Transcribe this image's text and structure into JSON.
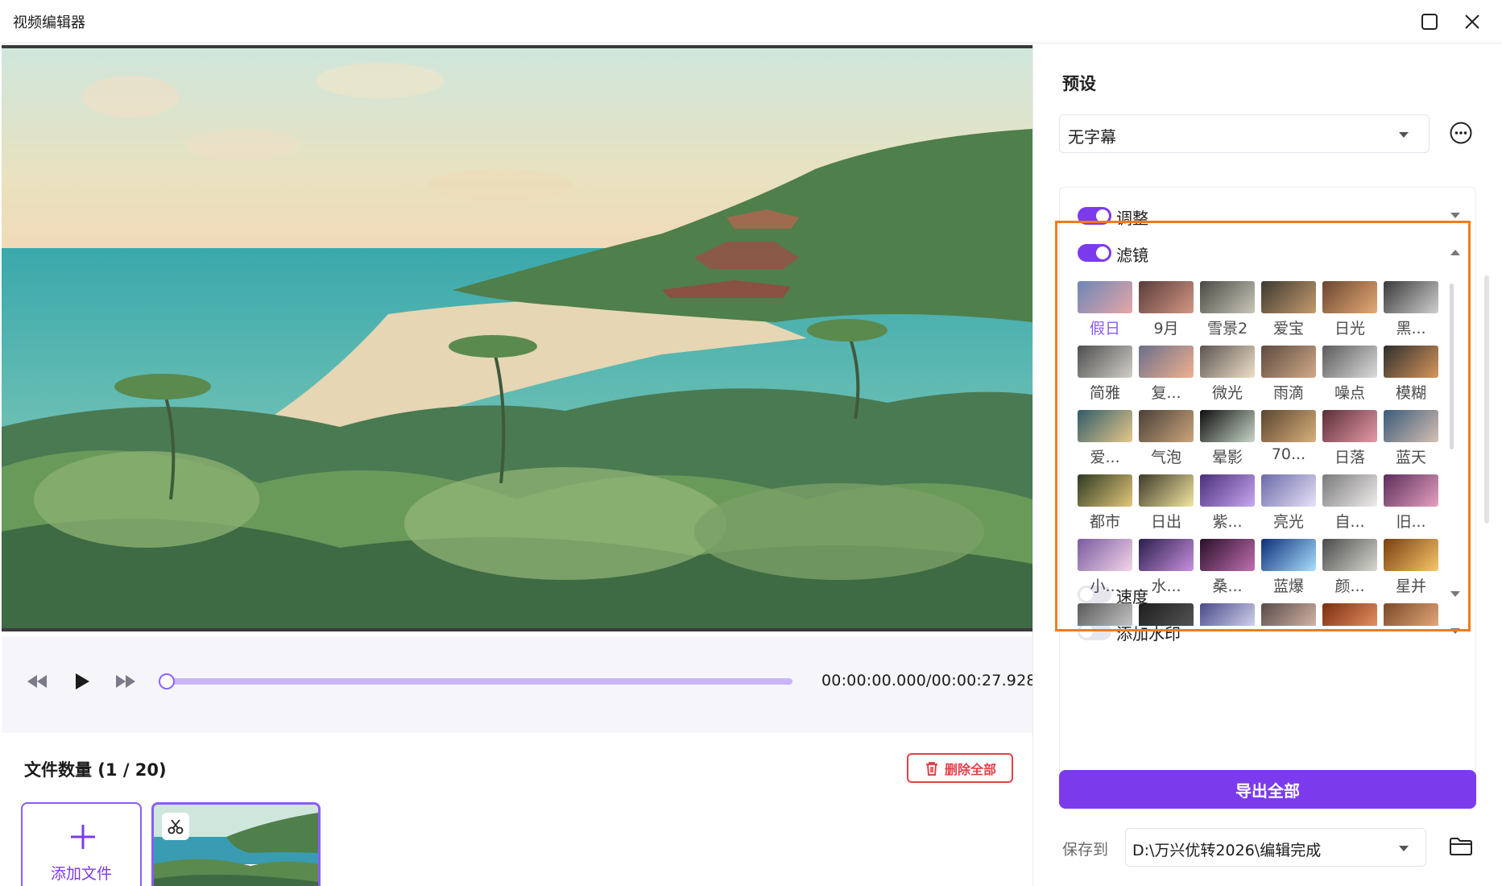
{
  "window": {
    "title": "视频编辑器"
  },
  "player": {
    "timecode": "00:00:00.000/00:00:27.928",
    "progress": 0.0
  },
  "files": {
    "count_label": "文件数量 (1 / 20)",
    "delete_all_label": "删除全部",
    "add_file_label": "添加文件"
  },
  "preset": {
    "label": "预设",
    "value": "无字幕"
  },
  "sections": {
    "adjust": {
      "label": "调整",
      "enabled": true
    },
    "filter": {
      "label": "滤镜",
      "enabled": true
    },
    "speed": {
      "label": "速度",
      "enabled": false
    },
    "watermark": {
      "label": "添加水印",
      "enabled": false
    }
  },
  "filters": [
    {
      "name": "假日",
      "selected": true,
      "colors": [
        "#6d86b8",
        "#e6a6a6"
      ]
    },
    {
      "name": "9月",
      "colors": [
        "#5a3d3a",
        "#d39684"
      ]
    },
    {
      "name": "雪景2",
      "colors": [
        "#4a4a44",
        "#c9c7b9"
      ]
    },
    {
      "name": "爱宝",
      "colors": [
        "#3e3a32",
        "#c49a6c"
      ]
    },
    {
      "name": "日光",
      "colors": [
        "#6b4630",
        "#e5a976"
      ]
    },
    {
      "name": "黑...",
      "colors": [
        "#3a3a3a",
        "#cfcfcf"
      ]
    },
    {
      "name": "简雅",
      "colors": [
        "#4e4e4e",
        "#d2cfc8"
      ]
    },
    {
      "name": "复...",
      "colors": [
        "#6c6f8a",
        "#f0b090"
      ]
    },
    {
      "name": "微光",
      "colors": [
        "#5b5450",
        "#efe0c8"
      ]
    },
    {
      "name": "雨滴",
      "colors": [
        "#5d4a40",
        "#d1a989"
      ]
    },
    {
      "name": "噪点",
      "colors": [
        "#5a5a5a",
        "#dcdcdc"
      ]
    },
    {
      "name": "模糊",
      "colors": [
        "#2e2e2e",
        "#d7965a"
      ]
    },
    {
      "name": "爱...",
      "colors": [
        "#2f5c6a",
        "#e6c88a"
      ]
    },
    {
      "name": "气泡",
      "colors": [
        "#4a4038",
        "#caa57c"
      ]
    },
    {
      "name": "晕影",
      "colors": [
        "#0f0f0f",
        "#c8d6c8"
      ]
    },
    {
      "name": "70...",
      "colors": [
        "#5a4630",
        "#d8b07c"
      ]
    },
    {
      "name": "日落",
      "colors": [
        "#5a2e38",
        "#e69aa8"
      ]
    },
    {
      "name": "蓝天",
      "colors": [
        "#3a5a7a",
        "#d6c0b0"
      ]
    },
    {
      "name": "都市",
      "colors": [
        "#2e3a22",
        "#e3c77a"
      ]
    },
    {
      "name": "日出",
      "colors": [
        "#3e3a2a",
        "#f2e6a0"
      ]
    },
    {
      "name": "紫...",
      "colors": [
        "#4a2e7a",
        "#c8a8f0"
      ]
    },
    {
      "name": "亮光",
      "colors": [
        "#6a6aa8",
        "#e8e2f8"
      ]
    },
    {
      "name": "自...",
      "colors": [
        "#7a7a7a",
        "#f0ecec"
      ]
    },
    {
      "name": "旧...",
      "colors": [
        "#5a2e5a",
        "#e6a0c0"
      ]
    },
    {
      "name": "小...",
      "colors": [
        "#7a5aa0",
        "#f2d6e8"
      ]
    },
    {
      "name": "水...",
      "colors": [
        "#2a1e4a",
        "#c890e0"
      ]
    },
    {
      "name": "桑...",
      "colors": [
        "#2a0e2a",
        "#c070b0"
      ]
    },
    {
      "name": "蓝爆",
      "colors": [
        "#0e2e7a",
        "#a8e0ff"
      ]
    },
    {
      "name": "颜...",
      "colors": [
        "#4a4a4a",
        "#d8d8d0"
      ]
    },
    {
      "name": "星并",
      "colors": [
        "#7a3e10",
        "#f7c66a"
      ]
    },
    {
      "name": "",
      "colors": [
        "#5a5a5a",
        "#d0d0d0"
      ]
    },
    {
      "name": "",
      "colors": [
        "#1e1e1e",
        "#5a5a5a"
      ]
    },
    {
      "name": "",
      "colors": [
        "#4a4a8a",
        "#e0e0f8"
      ]
    },
    {
      "name": "",
      "colors": [
        "#5a4a4a",
        "#e0c0b0"
      ]
    },
    {
      "name": "",
      "colors": [
        "#7a2e10",
        "#f29a6a"
      ]
    },
    {
      "name": "",
      "colors": [
        "#7a4a2a",
        "#f0b080"
      ]
    }
  ],
  "export": {
    "button_label": "导出全部",
    "save_to_label": "保存到",
    "save_path": "D:\\万兴优转2026\\编辑完成"
  },
  "colors": {
    "accent": "#7c3aed",
    "highlight": "#f07c1e",
    "danger": "#e4404b"
  }
}
